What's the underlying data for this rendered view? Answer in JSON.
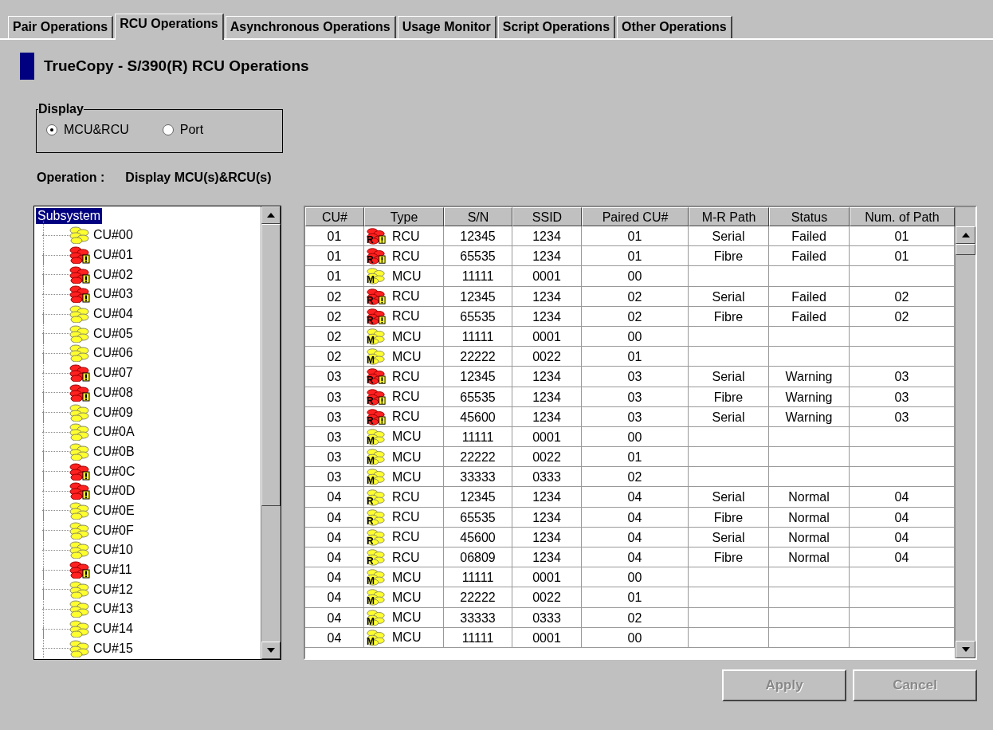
{
  "tabs": [
    {
      "label": "Pair Operations",
      "selected": false
    },
    {
      "label": "RCU Operations",
      "selected": true
    },
    {
      "label": "Asynchronous Operations",
      "selected": false
    },
    {
      "label": "Usage Monitor",
      "selected": false
    },
    {
      "label": "Script Operations",
      "selected": false
    },
    {
      "label": "Other Operations",
      "selected": false
    }
  ],
  "title": "TrueCopy - S/390(R) RCU Operations",
  "display": {
    "legend": "Display",
    "options": [
      {
        "label": "MCU&RCU",
        "selected": true
      },
      {
        "label": "Port",
        "selected": false
      }
    ]
  },
  "operation": {
    "label": "Operation :",
    "value": "Display MCU(s)&RCU(s)"
  },
  "tree": {
    "root": {
      "label": "Subsystem",
      "selected": true,
      "children": [
        {
          "label": "CU#00",
          "alert": false
        },
        {
          "label": "CU#01",
          "alert": true
        },
        {
          "label": "CU#02",
          "alert": true
        },
        {
          "label": "CU#03",
          "alert": true
        },
        {
          "label": "CU#04",
          "alert": false
        },
        {
          "label": "CU#05",
          "alert": false
        },
        {
          "label": "CU#06",
          "alert": false
        },
        {
          "label": "CU#07",
          "alert": true
        },
        {
          "label": "CU#08",
          "alert": true
        },
        {
          "label": "CU#09",
          "alert": false
        },
        {
          "label": "CU#0A",
          "alert": false
        },
        {
          "label": "CU#0B",
          "alert": false
        },
        {
          "label": "CU#0C",
          "alert": true
        },
        {
          "label": "CU#0D",
          "alert": true
        },
        {
          "label": "CU#0E",
          "alert": false
        },
        {
          "label": "CU#0F",
          "alert": false
        },
        {
          "label": "CU#10",
          "alert": false
        },
        {
          "label": "CU#11",
          "alert": true
        },
        {
          "label": "CU#12",
          "alert": false
        },
        {
          "label": "CU#13",
          "alert": false
        },
        {
          "label": "CU#14",
          "alert": false
        },
        {
          "label": "CU#15",
          "alert": false
        }
      ]
    }
  },
  "table": {
    "columns": [
      "CU#",
      "Type",
      "S/N",
      "SSID",
      "Paired CU#",
      "M-R Path",
      "Status",
      "Num. of Path"
    ],
    "rows": [
      {
        "cu": "01",
        "badge": "R",
        "alert": true,
        "type": "RCU",
        "sn": "12345",
        "ssid": "1234",
        "paired": "01",
        "path": "Serial",
        "status": "Failed",
        "num": "01"
      },
      {
        "cu": "01",
        "badge": "R",
        "alert": true,
        "type": "RCU",
        "sn": "65535",
        "ssid": "1234",
        "paired": "01",
        "path": "Fibre",
        "status": "Failed",
        "num": "01"
      },
      {
        "cu": "01",
        "badge": "M",
        "alert": false,
        "type": "MCU",
        "sn": "11111",
        "ssid": "0001",
        "paired": "00"
      },
      {
        "cu": "02",
        "badge": "R",
        "alert": true,
        "type": "RCU",
        "sn": "12345",
        "ssid": "1234",
        "paired": "02",
        "path": "Serial",
        "status": "Failed",
        "num": "02"
      },
      {
        "cu": "02",
        "badge": "R",
        "alert": true,
        "type": "RCU",
        "sn": "65535",
        "ssid": "1234",
        "paired": "02",
        "path": "Fibre",
        "status": "Failed",
        "num": "02"
      },
      {
        "cu": "02",
        "badge": "M",
        "alert": false,
        "type": "MCU",
        "sn": "11111",
        "ssid": "0001",
        "paired": "00"
      },
      {
        "cu": "02",
        "badge": "M",
        "alert": false,
        "type": "MCU",
        "sn": "22222",
        "ssid": "0022",
        "paired": "01"
      },
      {
        "cu": "03",
        "badge": "R",
        "alert": true,
        "type": "RCU",
        "sn": "12345",
        "ssid": "1234",
        "paired": "03",
        "path": "Serial",
        "status": "Warning",
        "num": "03"
      },
      {
        "cu": "03",
        "badge": "R",
        "alert": true,
        "type": "RCU",
        "sn": "65535",
        "ssid": "1234",
        "paired": "03",
        "path": "Fibre",
        "status": "Warning",
        "num": "03"
      },
      {
        "cu": "03",
        "badge": "R",
        "alert": true,
        "type": "RCU",
        "sn": "45600",
        "ssid": "1234",
        "paired": "03",
        "path": "Serial",
        "status": "Warning",
        "num": "03"
      },
      {
        "cu": "03",
        "badge": "M",
        "alert": false,
        "type": "MCU",
        "sn": "11111",
        "ssid": "0001",
        "paired": "00"
      },
      {
        "cu": "03",
        "badge": "M",
        "alert": false,
        "type": "MCU",
        "sn": "22222",
        "ssid": "0022",
        "paired": "01"
      },
      {
        "cu": "03",
        "badge": "M",
        "alert": false,
        "type": "MCU",
        "sn": "33333",
        "ssid": "0333",
        "paired": "02"
      },
      {
        "cu": "04",
        "badge": "R",
        "alert": false,
        "type": "RCU",
        "sn": "12345",
        "ssid": "1234",
        "paired": "04",
        "path": "Serial",
        "status": "Normal",
        "num": "04"
      },
      {
        "cu": "04",
        "badge": "R",
        "alert": false,
        "type": "RCU",
        "sn": "65535",
        "ssid": "1234",
        "paired": "04",
        "path": "Fibre",
        "status": "Normal",
        "num": "04"
      },
      {
        "cu": "04",
        "badge": "R",
        "alert": false,
        "type": "RCU",
        "sn": "45600",
        "ssid": "1234",
        "paired": "04",
        "path": "Serial",
        "status": "Normal",
        "num": "04"
      },
      {
        "cu": "04",
        "badge": "R",
        "alert": false,
        "type": "RCU",
        "sn": "06809",
        "ssid": "1234",
        "paired": "04",
        "path": "Fibre",
        "status": "Normal",
        "num": "04"
      },
      {
        "cu": "04",
        "badge": "M",
        "alert": false,
        "type": "MCU",
        "sn": "11111",
        "ssid": "0001",
        "paired": "00"
      },
      {
        "cu": "04",
        "badge": "M",
        "alert": false,
        "type": "MCU",
        "sn": "22222",
        "ssid": "0022",
        "paired": "01"
      },
      {
        "cu": "04",
        "badge": "M",
        "alert": false,
        "type": "MCU",
        "sn": "33333",
        "ssid": "0333",
        "paired": "02"
      },
      {
        "cu": "04",
        "badge": "M",
        "alert": false,
        "type": "MCU",
        "sn": "11111",
        "ssid": "0001",
        "paired": "00"
      }
    ]
  },
  "buttons": [
    {
      "label": "Apply",
      "disabled": true
    },
    {
      "label": "Cancel",
      "disabled": true
    }
  ]
}
